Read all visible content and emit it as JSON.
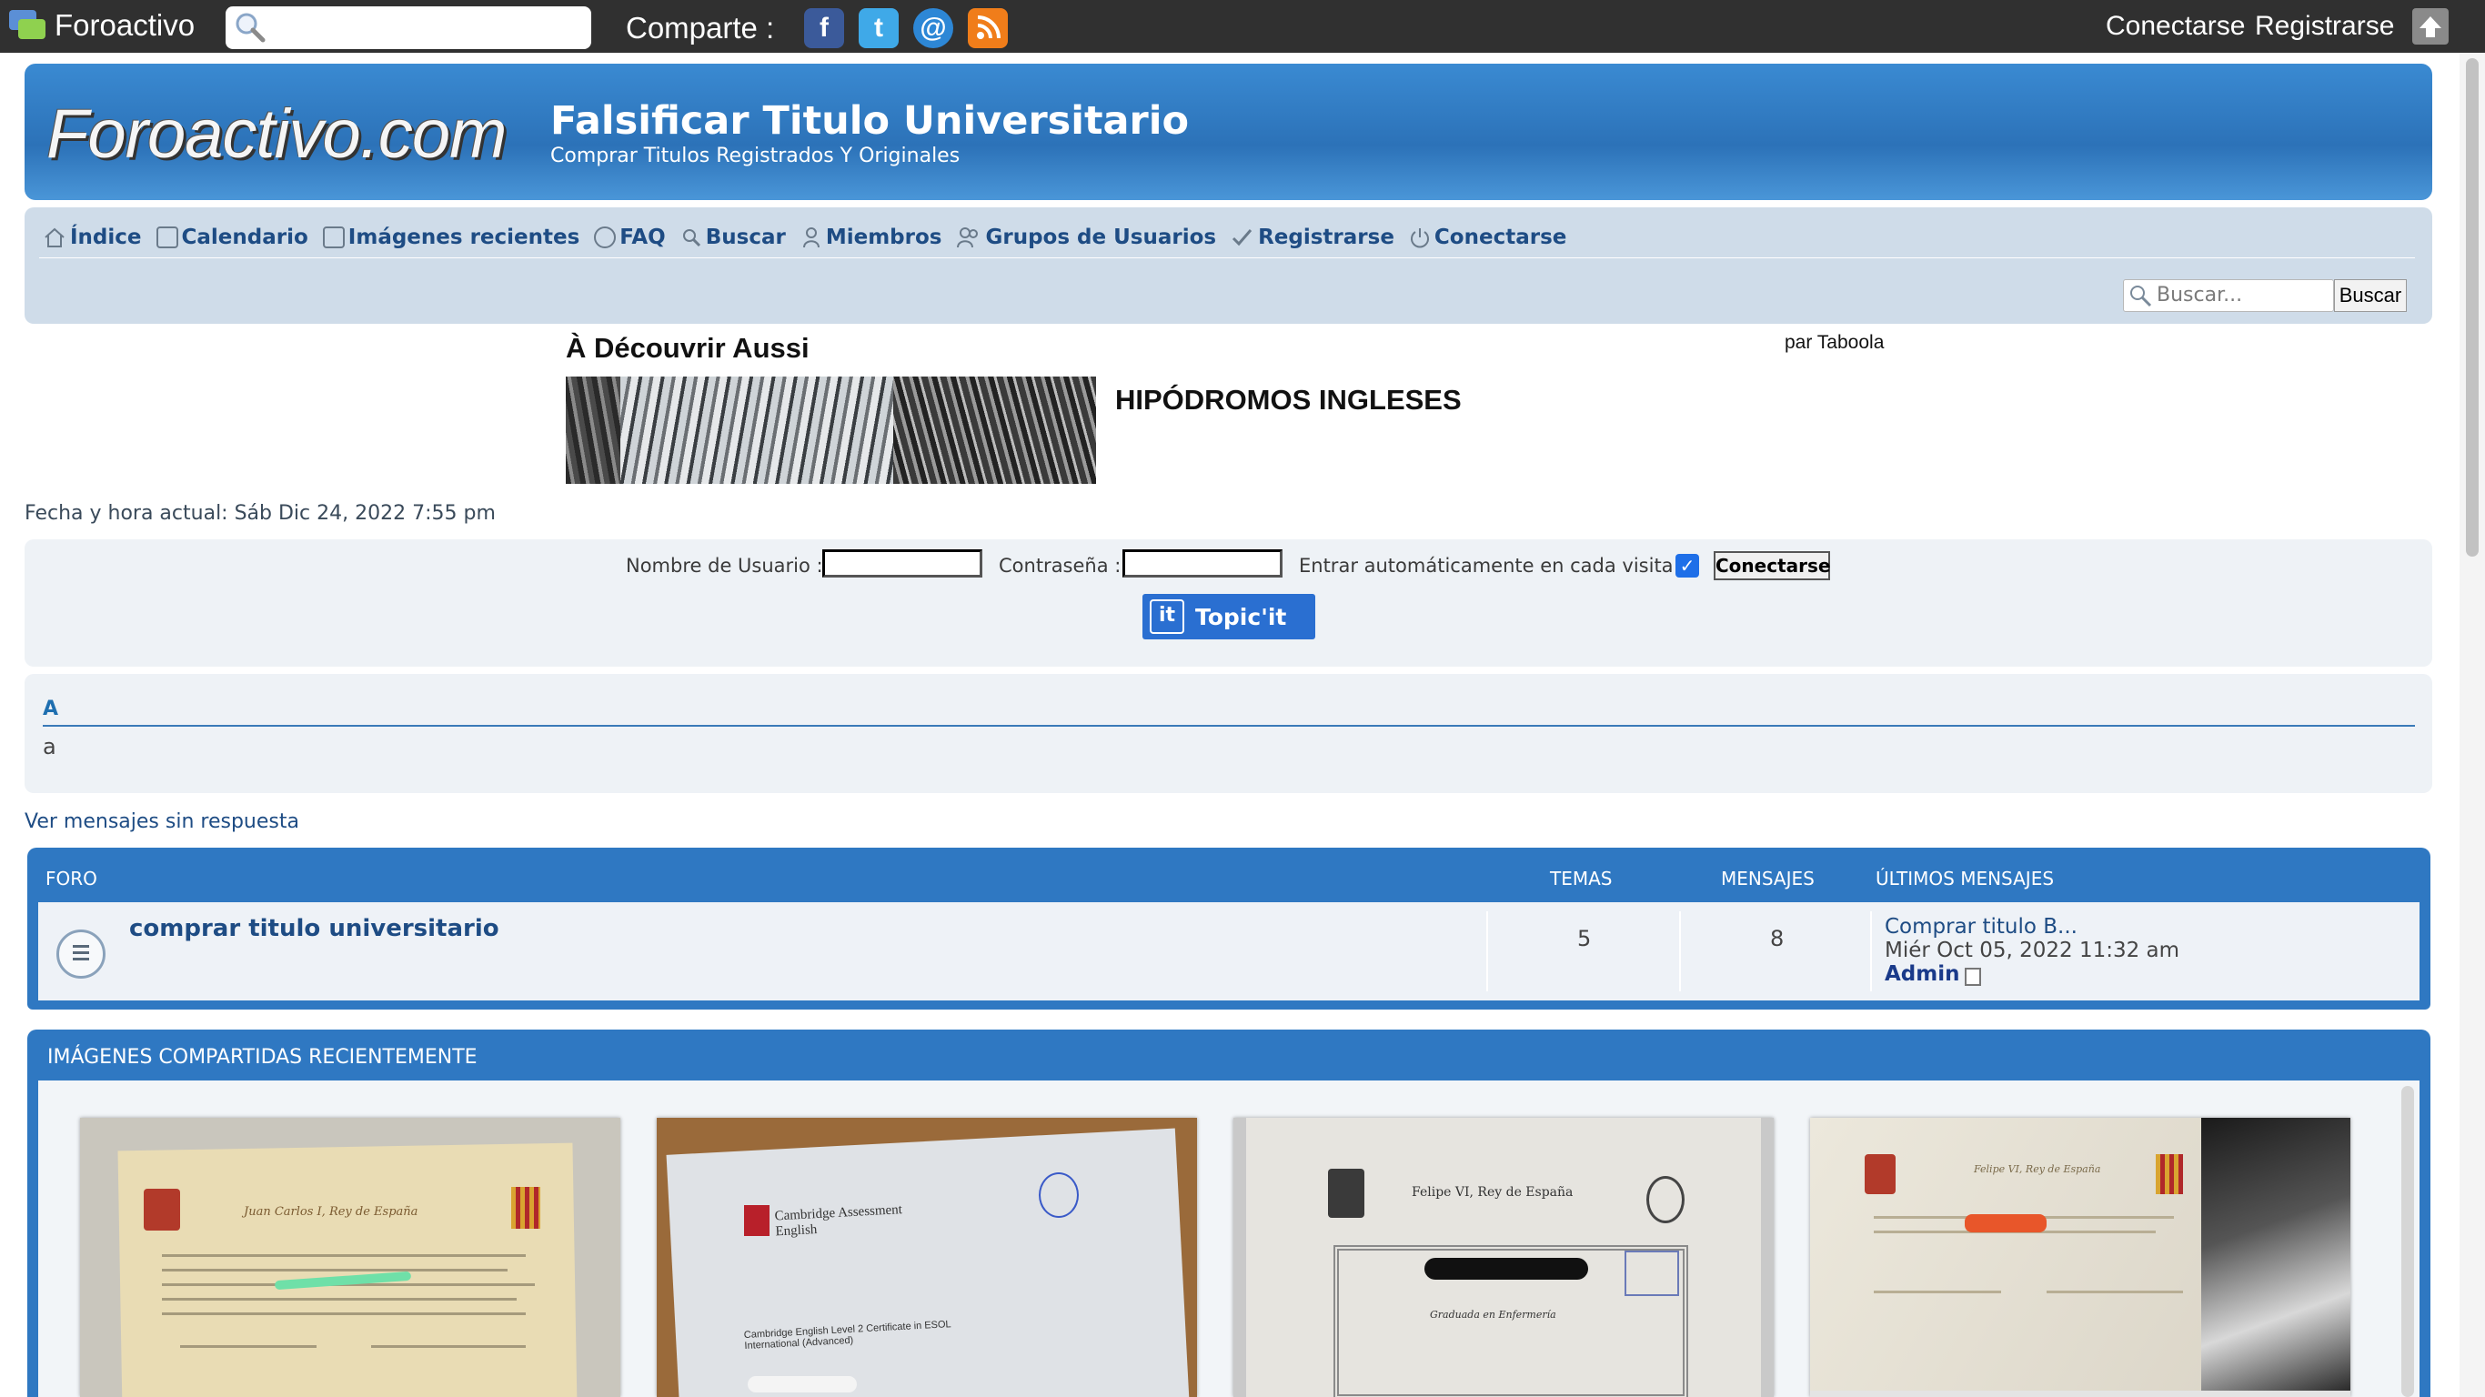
{
  "topbar": {
    "brand": "Foroactivo",
    "share_label": "Comparte :",
    "social_icons": [
      "facebook-icon",
      "twitter-icon",
      "email-icon",
      "rss-icon"
    ],
    "login": "Conectarse",
    "register": "Registrarse"
  },
  "header": {
    "logo": "Foroactivo.com",
    "title": "Falsificar Titulo Universitario",
    "subtitle": "Comprar Titulos Registrados Y Originales"
  },
  "nav": {
    "items": [
      {
        "label": "Índice",
        "icon": "home-icon"
      },
      {
        "label": "Calendario",
        "icon": "calendar-icon"
      },
      {
        "label": "Imágenes recientes",
        "icon": "image-icon"
      },
      {
        "label": "FAQ",
        "icon": "help-icon"
      },
      {
        "label": "Buscar",
        "icon": "search-icon"
      },
      {
        "label": "Miembros",
        "icon": "member-icon"
      },
      {
        "label": "Grupos de Usuarios",
        "icon": "groups-icon"
      },
      {
        "label": "Registrarse",
        "icon": "register-icon"
      },
      {
        "label": "Conectarse",
        "icon": "power-icon"
      }
    ],
    "search_placeholder": "Buscar...",
    "search_button": "Buscar"
  },
  "taboola": {
    "title": "À Découvrir Aussi",
    "credit": "par Taboola",
    "headline": "HIPÓDROMOS INGLESES"
  },
  "datetime": "Fecha y hora actual: Sáb Dic 24, 2022 7:55 pm",
  "login": {
    "username_label": "Nombre de Usuario :",
    "password_label": "Contraseña :",
    "auto_label": "Entrar automáticamente en cada visita :",
    "auto_checked": true,
    "button": "Conectarse",
    "topicit": "Topic'it",
    "topicit_badge": "it"
  },
  "announcement": {
    "title": "A",
    "text": "a"
  },
  "unanswered_link": "Ver mensajes sin respuesta",
  "forum_table": {
    "headers": {
      "forum": "FORO",
      "topics": "TEMAS",
      "posts": "MENSAJES",
      "last": "ÚLTIMOS MENSAJES"
    },
    "rows": [
      {
        "title": "comprar titulo universitario",
        "topics": "5",
        "posts": "8",
        "last_title": "Comprar titulo B...",
        "last_date": "Miér Oct 05, 2022 11:32 am",
        "last_author": "Admin"
      }
    ]
  },
  "images_box": {
    "title": "IMÁGENES COMPARTIDAS RECIENTEMENTE",
    "images": [
      {
        "text": "Juan Carlos I, Rey de España"
      },
      {
        "text": "Cambridge Assessment English",
        "cert_text": "Cambridge English Level 2 Certificate in ESOL International (Advanced)"
      },
      {
        "text": "Felipe VI, Rey de España",
        "sub_text": "Graduada en Enfermería"
      },
      {
        "text": "Felipe VI, Rey de España"
      }
    ]
  }
}
